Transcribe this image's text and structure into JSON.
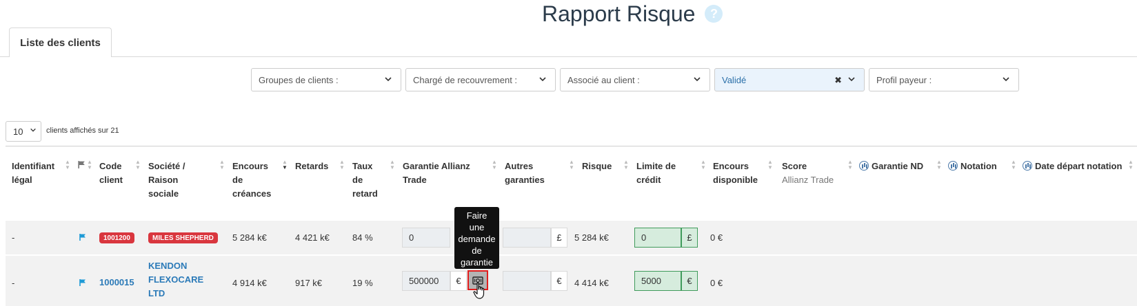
{
  "header": {
    "title_light": "Rapport",
    "title_bold": "Risque",
    "help_glyph": "?"
  },
  "tabs": [
    {
      "label": "Liste des clients"
    }
  ],
  "filters": [
    {
      "label": "Groupes de clients :",
      "selected": false
    },
    {
      "label": "Chargé de recouvrement :",
      "selected": false
    },
    {
      "label": "Associé au client :",
      "selected": false
    },
    {
      "label": "Validé",
      "selected": true
    },
    {
      "label": "Profil payeur :",
      "selected": false
    }
  ],
  "pager": {
    "page_size": "10",
    "summary": "clients affichés sur 21"
  },
  "columns": {
    "id_legal": "Identifiant légal",
    "code_client": "Code client",
    "societe": "Société / Raison sociale",
    "encours": "Encours de créances",
    "retards": "Retards",
    "taux": "Taux de retard",
    "garantie_allianz": "Garantie Allianz Trade",
    "autres_garanties": "Autres garanties",
    "risque": "Risque",
    "limite_credit": "Limite de crédit",
    "encours_dispo": "Encours disponible",
    "score": "Score",
    "score_sub": "Allianz Trade",
    "garantie_nd": "Garantie ND",
    "notation": "Notation",
    "date_notation": "Date départ notation"
  },
  "rows": [
    {
      "id_legal": "-",
      "code": "1001200",
      "societe": "MILES SHEPHERD",
      "encours": "5 284 k€",
      "retards": "4 421 k€",
      "taux": "84 %",
      "garantie_value": "0",
      "garantie_currency": "",
      "autres_value": "",
      "autres_currency": "£",
      "risque": "5 284 k€",
      "limite_value": "0",
      "limite_currency": "£",
      "encours_dispo": "0 €"
    },
    {
      "id_legal": "-",
      "code": "1000015",
      "societe_line1": "KENDON",
      "societe_line2": "FLEXOCARE",
      "societe_line3": "LTD",
      "encours": "4 914 k€",
      "retards": "917 k€",
      "taux": "19 %",
      "garantie_value": "500000",
      "garantie_currency": "€",
      "autres_value": "",
      "autres_currency": "€",
      "risque": "4 414 k€",
      "limite_value": "5000",
      "limite_currency": "€",
      "encours_dispo": "0 €"
    }
  ],
  "tooltip": {
    "text_lines": [
      "Faire",
      "une",
      "demande",
      "de",
      "garantie"
    ]
  },
  "colors": {
    "accent": "#2b7ab8",
    "badge": "#d9363e",
    "credit_ok": "#3f9a5a",
    "highlight": "#e11d1d"
  }
}
